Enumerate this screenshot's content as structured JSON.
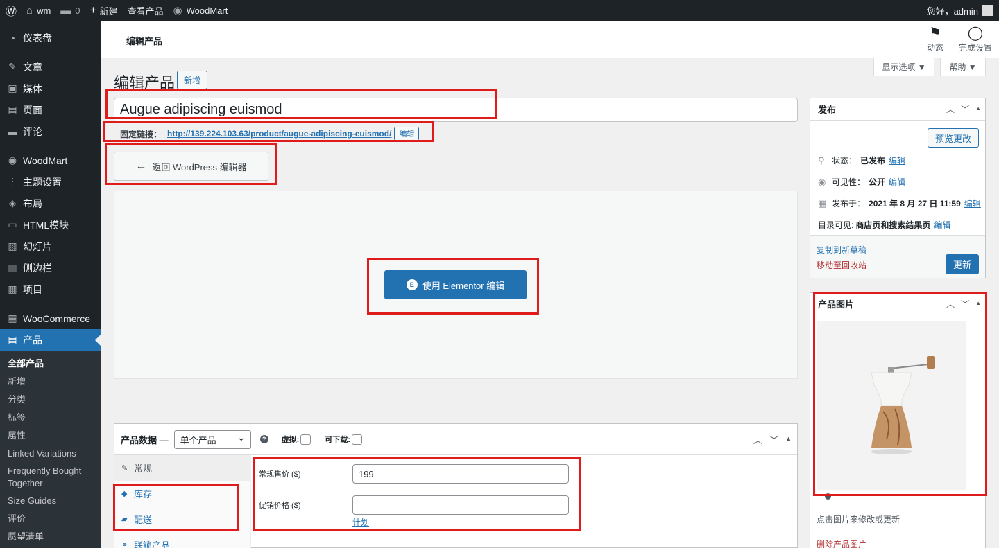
{
  "adminbar": {
    "site_name": "wm",
    "comments_count": "0",
    "new_label": "新建",
    "view_product": "查看产品",
    "woodmart": "WoodMart",
    "greeting": "您好，admin"
  },
  "sidebar": {
    "items": [
      {
        "icon": "dashboard-icon",
        "glyph": "◔",
        "label": "仪表盘"
      },
      {
        "icon": "pin-icon",
        "glyph": "✎",
        "label": "文章"
      },
      {
        "icon": "media-icon",
        "glyph": "▣",
        "label": "媒体"
      },
      {
        "icon": "page-icon",
        "glyph": "▤",
        "label": "页面"
      },
      {
        "icon": "comment-icon",
        "glyph": "▬",
        "label": "评论"
      },
      {
        "icon": "woodmart-icon",
        "glyph": "◉",
        "label": "WoodMart"
      },
      {
        "icon": "sliders-icon",
        "glyph": "⫶",
        "label": "主题设置"
      },
      {
        "icon": "layers-icon",
        "glyph": "◈",
        "label": "布局"
      },
      {
        "icon": "html-icon",
        "glyph": "▭",
        "label": "HTML模块"
      },
      {
        "icon": "slides-icon",
        "glyph": "▨",
        "label": "幻灯片"
      },
      {
        "icon": "sidebar-icon",
        "glyph": "▥",
        "label": "侧边栏"
      },
      {
        "icon": "briefcase-icon",
        "glyph": "▩",
        "label": "项目"
      },
      {
        "icon": "woocommerce-icon",
        "glyph": "▦",
        "label": "WooCommerce"
      },
      {
        "icon": "archive-icon",
        "glyph": "▤",
        "label": "产品"
      }
    ],
    "submenu": [
      "全部产品",
      "新增",
      "分类",
      "标签",
      "属性",
      "Linked Variations",
      "Frequently Bought Together",
      "Size Guides",
      "评价",
      "愿望清单"
    ]
  },
  "header": {
    "title": "编辑产品",
    "activity": "动态",
    "finish_setup": "完成设置",
    "screen_options": "显示选项 ▼",
    "help": "帮助 ▼"
  },
  "main": {
    "page_title": "编辑产品",
    "add_new": "新增",
    "product_title": "Augue adipiscing euismod",
    "permalink_label": "固定链接：",
    "permalink_base": "http://139.224.103.63/product/",
    "permalink_slug": "augue-adipiscing-euismod",
    "permalink_tail": "/",
    "permalink_edit": "编辑",
    "back_button": "返回 WordPress 编辑器",
    "elementor_button": "使用 Elementor 编辑"
  },
  "product_data": {
    "title": "产品数据 —",
    "type": "单个产品",
    "virtual": "虚拟:",
    "downloadable": "可下载:",
    "tabs": [
      {
        "icon": "wrench-icon",
        "glyph": "✎",
        "label": "常规"
      },
      {
        "icon": "tag-icon",
        "glyph": "◆",
        "label": "库存"
      },
      {
        "icon": "truck-icon",
        "glyph": "▰",
        "label": "配送"
      },
      {
        "icon": "link-icon",
        "glyph": "⚭",
        "label": "联锁产品"
      }
    ],
    "regular_price_label": "常规售价 ($)",
    "regular_price": "199",
    "sale_price_label": "促销价格 ($)",
    "sale_price": "",
    "schedule": "计划"
  },
  "publish": {
    "title": "发布",
    "preview": "预览更改",
    "status_label": "状态：",
    "status": "已发布",
    "visibility_label": "可见性：",
    "visibility": "公开",
    "published_label": "发布于：",
    "published": "2021 年 8 月 27 日 11:59",
    "catalog_label": "目录可见:",
    "catalog": "商店页和搜索结果页",
    "edit": "编辑",
    "copy_draft": "复制到新草稿",
    "trash": "移动至回收站",
    "update": "更新"
  },
  "product_image": {
    "title": "产品图片",
    "caption": "点击图片来修改或更新",
    "remove": "删除产品图片"
  },
  "colors": {
    "accent": "#2271b1",
    "annotation": "#e01b1b",
    "sidebar_bg": "#1d2327"
  }
}
